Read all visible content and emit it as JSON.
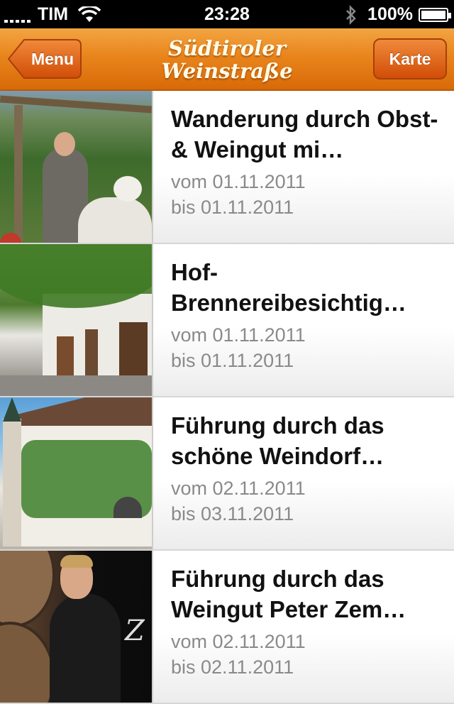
{
  "status_bar": {
    "carrier": "TIM",
    "time": "23:28",
    "battery": "100%",
    "icons": [
      "signal-icon",
      "wifi-icon",
      "bluetooth-icon",
      "battery-icon"
    ]
  },
  "nav": {
    "title_line1": "Südtiroler",
    "title_line2": "Weinstraße",
    "back_label": "Menu",
    "right_label": "Karte",
    "colors": {
      "bar": "#e9851c",
      "button": "#d14d08"
    }
  },
  "events": [
    {
      "title": "Wanderung durch Obst- & Weingut mi…",
      "from": "vom 01.11.2011",
      "to": "bis 01.11.2011"
    },
    {
      "title": "Hof-Brennereibesichtig…",
      "from": "vom 01.11.2011",
      "to": "bis 01.11.2011"
    },
    {
      "title": "Führung durch das schöne Weindorf…",
      "from": "vom 02.11.2011",
      "to": "bis 03.11.2011"
    },
    {
      "title": "Führung durch das Weingut Peter Zem…",
      "from": "vom 02.11.2011",
      "to": "bis 02.11.2011"
    }
  ]
}
